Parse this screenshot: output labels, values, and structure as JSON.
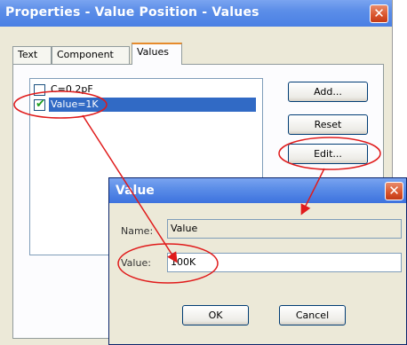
{
  "main_window": {
    "title": "Properties - Value Position - Values",
    "close_glyph": "✕",
    "tabs": [
      {
        "label": "Text"
      },
      {
        "label": "Component"
      },
      {
        "label": "Values",
        "active": true
      }
    ],
    "list_items": [
      {
        "label": "C=0.2pF",
        "checked": false
      },
      {
        "label": "Value=1K",
        "checked": true,
        "selected": true
      }
    ],
    "buttons": {
      "add": "Add...",
      "reset": "Reset",
      "edit": "Edit..."
    }
  },
  "value_dialog": {
    "title": "Value",
    "close_glyph": "✕",
    "name_label": "Name:",
    "name_value": "Value",
    "value_label": "Value:",
    "value_value": "100K",
    "ok_label": "OK",
    "cancel_label": "Cancel"
  },
  "annotations": {
    "ellipse_color": "#e01b1b",
    "arrow_color": "#e01b1b"
  },
  "colors": {
    "titlebar": "#5c8ee8",
    "selection": "#316ac5",
    "tab_accent": "#e68b2c",
    "dialog_bg": "#ece9d8"
  }
}
